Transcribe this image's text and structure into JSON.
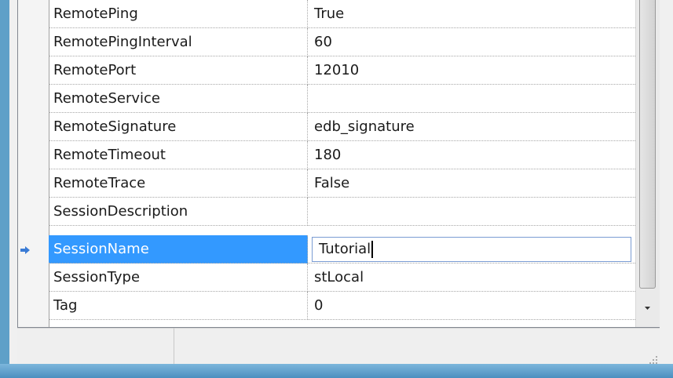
{
  "grid": {
    "rows": [
      {
        "name": "RemotePing",
        "value": "True"
      },
      {
        "name": "RemotePingInterval",
        "value": "60"
      },
      {
        "name": "RemotePort",
        "value": "12010"
      },
      {
        "name": "RemoteService",
        "value": ""
      },
      {
        "name": "RemoteSignature",
        "value": "edb_signature"
      },
      {
        "name": "RemoteTimeout",
        "value": "180"
      },
      {
        "name": "RemoteTrace",
        "value": "False"
      },
      {
        "name": "SessionDescription",
        "value": ""
      },
      {
        "name": "SessionName",
        "value": "Tutorial"
      },
      {
        "name": "SessionType",
        "value": "stLocal"
      },
      {
        "name": "Tag",
        "value": "0"
      }
    ],
    "selected_index": 8
  },
  "colors": {
    "selection": "#3399ff",
    "frame": "#5ea0c8",
    "arrow": "#3a7bd5"
  },
  "icons": {
    "current_row": "right-arrow-icon",
    "scroll_down": "chevron-down-icon",
    "resize": "size-grip-icon"
  }
}
